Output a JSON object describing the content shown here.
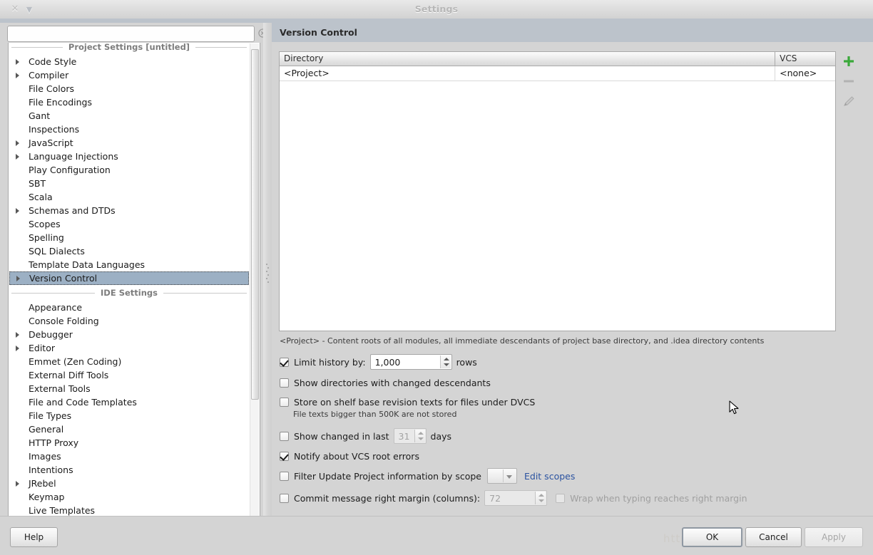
{
  "window": {
    "title": "Settings",
    "close_icon": "close-icon",
    "menu_icon": "chevron-down-icon"
  },
  "sidebar": {
    "search": {
      "value": "",
      "placeholder": ""
    },
    "clear_icon": "clear-circle-icon",
    "sections": [
      {
        "header": "Project Settings [untitled]",
        "items": [
          {
            "label": "Code Style",
            "expandable": true,
            "selected": false
          },
          {
            "label": "Compiler",
            "expandable": true,
            "selected": false
          },
          {
            "label": "File Colors",
            "expandable": false,
            "selected": false
          },
          {
            "label": "File Encodings",
            "expandable": false,
            "selected": false
          },
          {
            "label": "Gant",
            "expandable": false,
            "selected": false
          },
          {
            "label": "Inspections",
            "expandable": false,
            "selected": false
          },
          {
            "label": "JavaScript",
            "expandable": true,
            "selected": false
          },
          {
            "label": "Language Injections",
            "expandable": true,
            "selected": false
          },
          {
            "label": "Play Configuration",
            "expandable": false,
            "selected": false
          },
          {
            "label": "SBT",
            "expandable": false,
            "selected": false
          },
          {
            "label": "Scala",
            "expandable": false,
            "selected": false
          },
          {
            "label": "Schemas and DTDs",
            "expandable": true,
            "selected": false
          },
          {
            "label": "Scopes",
            "expandable": false,
            "selected": false
          },
          {
            "label": "Spelling",
            "expandable": false,
            "selected": false
          },
          {
            "label": "SQL Dialects",
            "expandable": false,
            "selected": false
          },
          {
            "label": "Template Data Languages",
            "expandable": false,
            "selected": false
          },
          {
            "label": "Version Control",
            "expandable": true,
            "selected": true
          }
        ]
      },
      {
        "header": "IDE Settings",
        "items": [
          {
            "label": "Appearance",
            "expandable": false,
            "selected": false
          },
          {
            "label": "Console Folding",
            "expandable": false,
            "selected": false
          },
          {
            "label": "Debugger",
            "expandable": true,
            "selected": false
          },
          {
            "label": "Editor",
            "expandable": true,
            "selected": false
          },
          {
            "label": "Emmet (Zen Coding)",
            "expandable": false,
            "selected": false
          },
          {
            "label": "External Diff Tools",
            "expandable": false,
            "selected": false
          },
          {
            "label": "External Tools",
            "expandable": false,
            "selected": false
          },
          {
            "label": "File and Code Templates",
            "expandable": false,
            "selected": false
          },
          {
            "label": "File Types",
            "expandable": false,
            "selected": false
          },
          {
            "label": "General",
            "expandable": false,
            "selected": false
          },
          {
            "label": "HTTP Proxy",
            "expandable": false,
            "selected": false
          },
          {
            "label": "Images",
            "expandable": false,
            "selected": false
          },
          {
            "label": "Intentions",
            "expandable": false,
            "selected": false
          },
          {
            "label": "JRebel",
            "expandable": true,
            "selected": false
          },
          {
            "label": "Keymap",
            "expandable": false,
            "selected": false
          },
          {
            "label": "Live Templates",
            "expandable": false,
            "selected": false
          }
        ]
      }
    ]
  },
  "main": {
    "title": "Version Control",
    "table": {
      "columns": [
        "Directory",
        "VCS"
      ],
      "rows": [
        {
          "directory": "<Project>",
          "vcs": "<none>"
        }
      ]
    },
    "table_buttons": [
      {
        "name": "add-button",
        "glyph": "+",
        "enabled": true,
        "color": "#3aa93a"
      },
      {
        "name": "remove-button",
        "glyph": "–",
        "enabled": false,
        "color": "#a8a8a8"
      },
      {
        "name": "edit-button",
        "glyph": "pencil-icon",
        "enabled": false,
        "color": "#a8a8a8"
      }
    ],
    "hint": "<Project> - Content roots of all modules, all immediate descendants of project base directory, and .idea directory contents",
    "options": {
      "limit_history": {
        "label": "Limit history by:",
        "checked": true,
        "value": "1,000",
        "suffix": "rows"
      },
      "show_changed_descendants": {
        "label": "Show directories with changed descendants",
        "checked": false
      },
      "store_on_shelf": {
        "label": "Store on shelf base revision texts for files under DVCS",
        "checked": false,
        "note": "File texts bigger than 500K are not stored"
      },
      "show_changed_in_last": {
        "label": "Show changed in last",
        "checked": false,
        "value": "31",
        "suffix": "days",
        "enabled": false
      },
      "notify_vcs_root_errors": {
        "label": "Notify about VCS root errors",
        "checked": true
      },
      "filter_by_scope": {
        "label": "Filter Update Project information by scope",
        "checked": false,
        "scope_value": "",
        "link": "Edit scopes"
      },
      "commit_margin": {
        "label": "Commit message right margin (columns):",
        "checked": false,
        "value": "72",
        "enabled": false,
        "wrap_label": "Wrap when typing reaches right margin",
        "wrap_checked": false
      }
    }
  },
  "footer": {
    "help": "Help",
    "ok": "OK",
    "cancel": "Cancel",
    "apply": "Apply",
    "watermark": "http://blog.csdn.net/"
  }
}
